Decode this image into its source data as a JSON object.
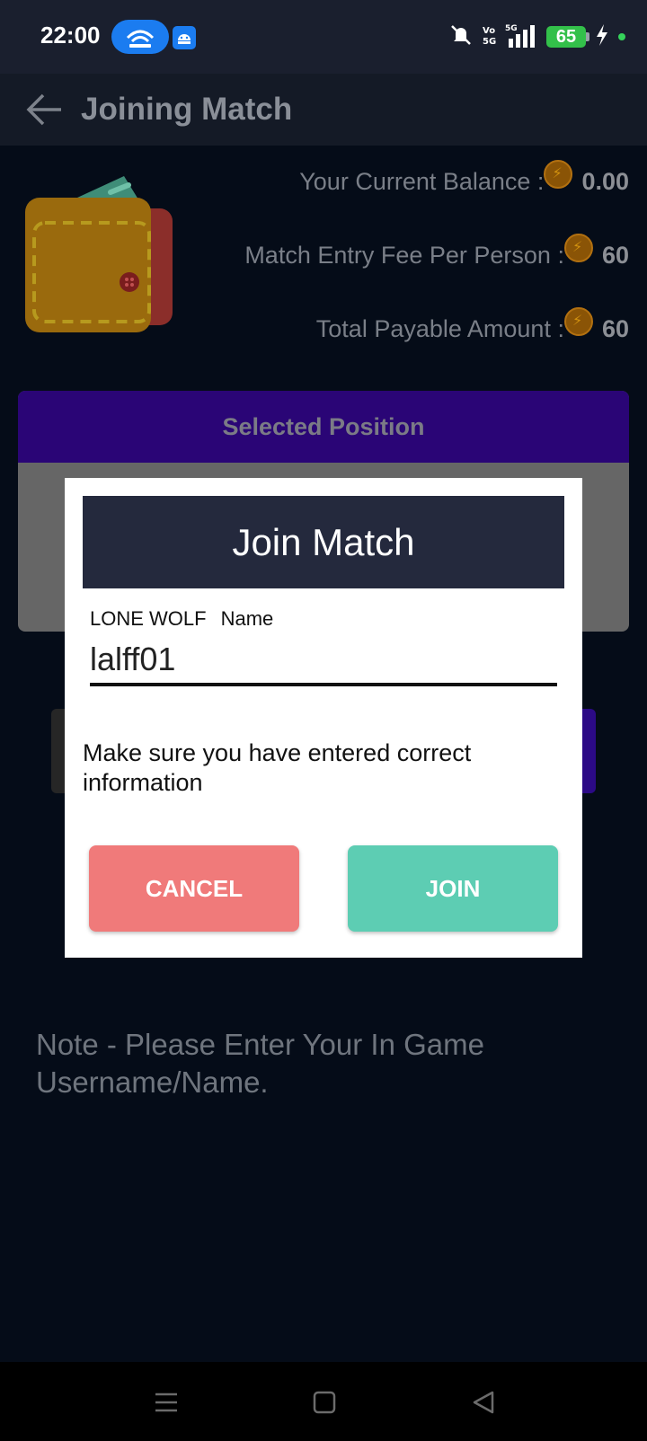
{
  "status_bar": {
    "time": "22:00",
    "battery": "65",
    "icons": [
      "hotspot-icon",
      "android-icon",
      "mute-icon",
      "volte-icon",
      "signal-5g-icon",
      "battery-icon",
      "charging-icon"
    ]
  },
  "app_bar": {
    "title": "Joining Match",
    "back_icon": "arrow-left-icon"
  },
  "balance": {
    "current_label": "Your Current Balance :",
    "current_value": "0.00",
    "fee_label": "Match Entry Fee Per Person :",
    "fee_value": "60",
    "total_label": "Total Payable Amount :",
    "total_value": "60",
    "coin_icon": "coin-icon"
  },
  "position_card": {
    "title": "Selected Position"
  },
  "note": "Note - Please Enter Your In Game Username/Name.",
  "dialog": {
    "title": "Join Match",
    "field_prefix": "LONE WOLF",
    "field_label": "Name",
    "field_value": "lalff01",
    "warning": "Make sure you have entered correct information",
    "cancel_label": "CANCEL",
    "join_label": "JOIN"
  },
  "colors": {
    "dialog_header": "#24293d",
    "cancel": "#f07a7a",
    "join": "#5dcdb3",
    "position_header": "#2a0576"
  }
}
